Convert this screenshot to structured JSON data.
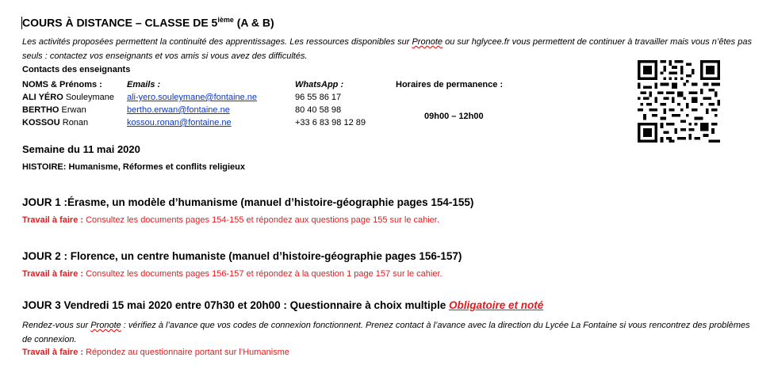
{
  "header": {
    "title_main": "COURS À DISTANCE – CLASSE DE 5",
    "title_sup": "ième",
    "title_end": " (A & B)"
  },
  "intro": {
    "part1": "Les activités proposées permettent la continuité des apprentissages. Les ressources disponibles sur ",
    "pronote": "Pronote",
    "part2": " ou sur hglycee.fr vous permettent de continuer à travailler mais vous n’êtes pas seuls : contactez vos enseignants et vos amis si vous avez des difficultés."
  },
  "contacts": {
    "heading": "Contacts des enseignants",
    "col_names": "NOMS & Prénoms :",
    "col_emails": "Emails :",
    "col_whatsapp": "WhatsApp :",
    "col_hours": "Horaires de permanence :",
    "hours": "09h00 – 12h00",
    "rows": [
      {
        "surname": "ALI YÉRO",
        "first": " Souleymane",
        "email": "ali-yero.souleymane@fontaine.ne",
        "phone": "96 55 86 17"
      },
      {
        "surname": "BERTHO",
        "first": " Erwan",
        "email": "bertho.erwan@fontaine.ne",
        "phone": "80 40 58 98"
      },
      {
        "surname": "KOSSOU",
        "first": " Ronan",
        "email": "kossou.ronan@fontaine.ne",
        "phone": "+33 6 83 98 12 89"
      }
    ]
  },
  "week": {
    "title": "Semaine du 11 mai 2020",
    "topic": "HISTOIRE: Humanisme, Réformes et conflits religieux"
  },
  "days": [
    {
      "title": "JOUR 1 :Érasme, un modèle d’humanisme (manuel d’histoire-géographie pages 154-155)",
      "task_label": "Travail à faire :",
      "task_text": " Consultez les documents pages 154-155 et répondez aux questions page 155 sur le cahier."
    },
    {
      "title": "JOUR 2 : Florence, un centre humaniste (manuel d’histoire-géographie pages 156-157)",
      "task_label": "Travail à faire :",
      "task_text": " Consultez les documents pages 156-157 et répondez à la question 1 page 157 sur le cahier."
    },
    {
      "title": "JOUR 3 Vendredi 15 mai 2020 entre 07h30 et 20h00 : Questionnaire à choix multiple ",
      "mandatory": "Obligatoire et noté",
      "note_part1": "Rendez-vous sur ",
      "note_pronote": "Pronote",
      "note_part2": " : vérifiez à l’avance que vos codes de connexion fonctionnent. Prenez contact à l’avance avec la direction du Lycée La Fontaine si vous rencontrez des problèmes de connexion.",
      "task_label": "Travail à faire :",
      "task_text": " Répondez au questionnaire  portant sur l’Humanisme"
    }
  ],
  "qr_code": {
    "icon": "qr-code-icon"
  }
}
